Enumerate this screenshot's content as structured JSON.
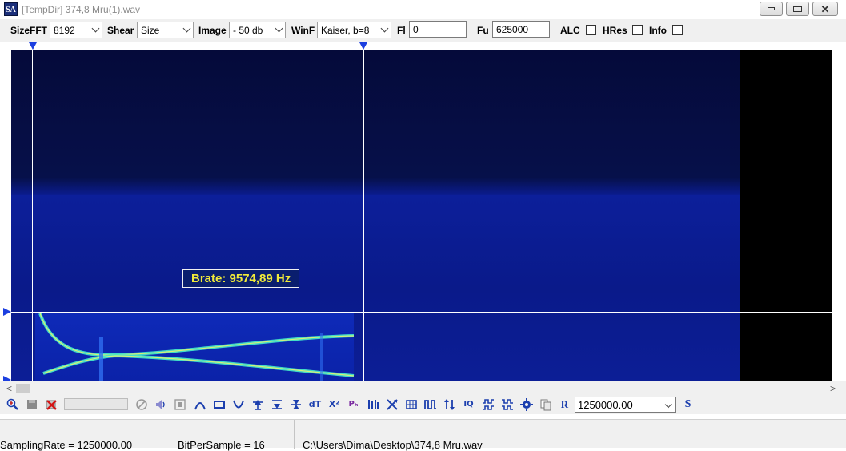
{
  "window": {
    "icon_text": "SA",
    "title": "[TempDir] 374,8 Mru(1).wav"
  },
  "controls": {
    "sizefft": {
      "label": "SizeFFT",
      "value": "8192"
    },
    "shear": {
      "label": "Shear",
      "value": "Size"
    },
    "image": {
      "label": "Image",
      "value": "- 50 db"
    },
    "winf": {
      "label": "WinF",
      "value": "Kaiser, b=8"
    },
    "fl": {
      "label": "Fl",
      "value": "0"
    },
    "fu": {
      "label": "Fu",
      "value": "625000"
    },
    "alc": {
      "label": "ALC",
      "checked": false
    },
    "hres": {
      "label": "HRes",
      "checked": false
    },
    "info": {
      "label": "Info",
      "checked": false
    }
  },
  "spectrogram": {
    "overlay_label": "Brate: 9574,89 Hz",
    "colors": {
      "background": "#000000",
      "noise_floor": "#0a1a8c",
      "signal": "#3fe8c8",
      "cursor": "#ffffff",
      "marker": "#1c3fe0"
    }
  },
  "toolbar": {
    "icons": [
      "zoom-in-icon",
      "save-icon",
      "delete-icon",
      "cancel-icon",
      "sound-icon",
      "stop-icon",
      "arc-icon",
      "rectangle-icon",
      "valley-icon",
      "marker-up-icon",
      "marker-down-icon",
      "marker-both-icon",
      "dt-icon",
      "x-squared-icon",
      "phase-icon",
      "bars-icon",
      "cross-icon",
      "grid-icon",
      "pulse-icon",
      "swap-icon",
      "iq-icon",
      "pattern-a-icon",
      "pattern-b-icon",
      "gear-icon",
      "copy-icon"
    ],
    "r_button": "R",
    "rate_value": "1250000.00",
    "s_button": "S"
  },
  "status": {
    "sampling_rate": "SamplingRate = 1250000.00",
    "bits_per_sample": "BitPerSample = 16",
    "file_path": "C:\\Users\\Dima\\Desktop\\374,8 Mru.wav"
  }
}
